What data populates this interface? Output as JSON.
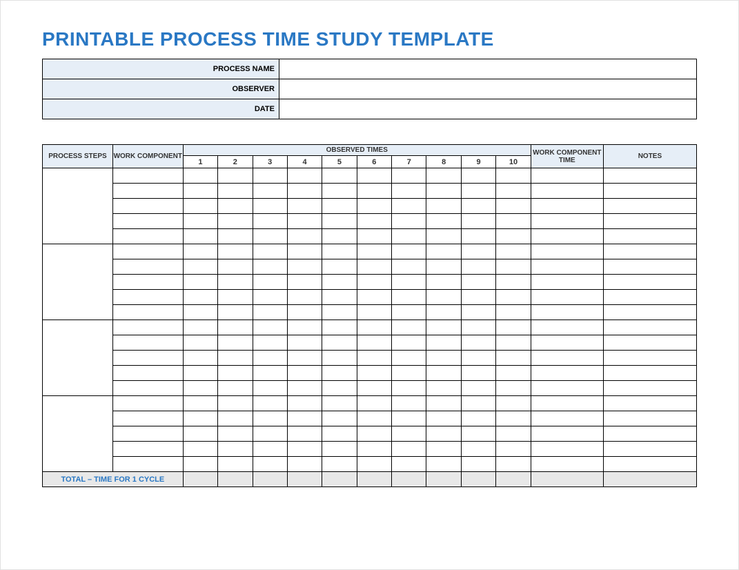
{
  "title": "PRINTABLE PROCESS TIME STUDY TEMPLATE",
  "info": {
    "process_name_label": "PROCESS NAME",
    "process_name_value": "",
    "observer_label": "OBSERVER",
    "observer_value": "",
    "date_label": "DATE",
    "date_value": ""
  },
  "headers": {
    "process_steps": "PROCESS STEPS",
    "work_component": "WORK COMPONENT",
    "observed_times": "OBSERVED TIMES",
    "work_component_time": "WORK COMPONENT TIME",
    "notes": "NOTES",
    "nums": [
      "1",
      "2",
      "3",
      "4",
      "5",
      "6",
      "7",
      "8",
      "9",
      "10"
    ]
  },
  "total_label": "TOTAL – TIME FOR 1 CYCLE",
  "groups": [
    {
      "rows": 5
    },
    {
      "rows": 5
    },
    {
      "rows": 5
    },
    {
      "rows": 5
    }
  ]
}
